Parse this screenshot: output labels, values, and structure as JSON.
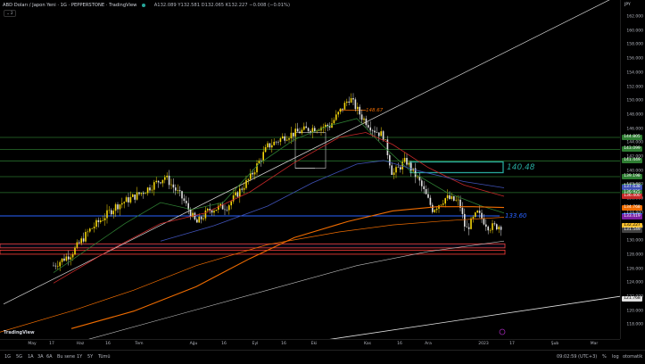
{
  "header": {
    "symbol_title": "ABD Doları / Japon Yeni · 1G · PEPPERSTONE · TradingView",
    "ohlc": "A132.089 Y132.581 D132.065 K132.227 −0.008 (−0.01%)",
    "collapse_label": "⌄ 2",
    "status_color": "#26a69a"
  },
  "price_axis": {
    "currency": "JPY",
    "ticks": [
      "162.000",
      "160.000",
      "158.000",
      "156.000",
      "154.000",
      "152.000",
      "150.000",
      "148.000",
      "146.000",
      "144.000",
      "142.000",
      "140.000",
      "138.000",
      "136.000",
      "134.000",
      "132.000",
      "130.000",
      "128.000",
      "126.000",
      "124.000",
      "122.000",
      "120.000",
      "118.000"
    ],
    "badges": [
      {
        "text": "144.805",
        "color": "#2e7d32",
        "price": 144.805
      },
      {
        "text": "143.099",
        "color": "#2e7d32",
        "price": 143.099
      },
      {
        "text": "141.449",
        "color": "#2e7d32",
        "price": 141.449
      },
      {
        "text": "139.198",
        "color": "#2e7d32",
        "price": 139.198
      },
      {
        "text": "137.821",
        "color": "#2e7d32",
        "price": 137.821
      },
      {
        "text": "137.638",
        "color": "#3f51b5",
        "price": 137.638
      },
      {
        "text": "136.925",
        "color": "#2e7d32",
        "price": 136.925
      },
      {
        "text": "136.400",
        "color": "#c62828",
        "price": 136.4
      },
      {
        "text": "134.768",
        "color": "#ef6c00",
        "price": 134.768
      },
      {
        "text": "133.568",
        "color": "#2962ff",
        "price": 133.568
      },
      {
        "text": "133.419",
        "color": "#7b1fa2",
        "price": 133.419
      },
      {
        "text": "132.227",
        "color": "#fbc02d",
        "price": 132.227
      },
      {
        "text": "131.549",
        "color": "#424242",
        "price": 131.549
      },
      {
        "text": "121.768",
        "color": "#e0e0e0",
        "price": 121.768
      }
    ]
  },
  "annotations": {
    "high_label": "148.67",
    "box_label": "140.48",
    "line_label": "133.60"
  },
  "time_axis": {
    "labels": [
      "May",
      "17",
      "Haz",
      "16",
      "Tem",
      "Ağu",
      "16",
      "Eyl",
      "16",
      "Eki",
      "Kas",
      "16",
      "Ara",
      "2023",
      "17",
      "Şub",
      "Mar"
    ]
  },
  "bottom_bar": {
    "periods": [
      "1G",
      "5G",
      "1A",
      "3A",
      "6A",
      "Bu sene",
      "1Y",
      "5Y",
      "Tümü"
    ],
    "clock": "09:02:59 (UTC+3)",
    "options": [
      "%",
      "log",
      "otomatik"
    ]
  },
  "logo_text": "TradingView",
  "colors": {
    "up": "#f5d60a",
    "down": "#e0e0e0",
    "ma_green": "#2e7d32",
    "ma_red": "#c62828",
    "ma_blue": "#3f51b5",
    "ma_orange": "#ef6c00",
    "ma_white": "#bdbdbd",
    "support_blue": "#2962ff",
    "zone_green": "#26a69a",
    "zone_red": "#e53935"
  }
}
